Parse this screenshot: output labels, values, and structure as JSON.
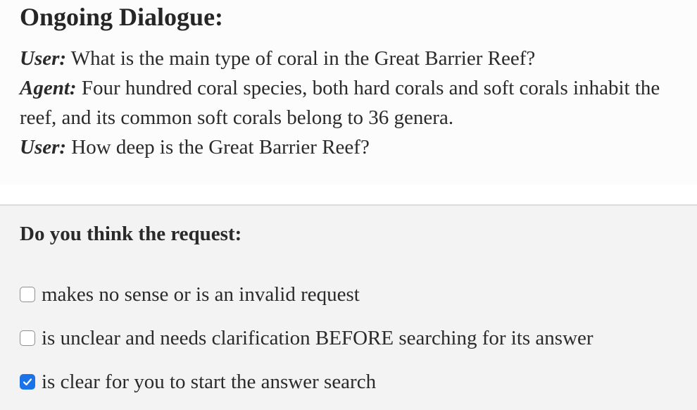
{
  "dialogue": {
    "title": "Ongoing Dialogue:",
    "turns": [
      {
        "speaker": "User:",
        "text": "What is the main type of coral in the Great Barrier Reef?"
      },
      {
        "speaker": "Agent:",
        "text": "Four hundred coral species, both hard corals and soft corals inhabit the reef, and its common soft corals belong to 36 genera."
      },
      {
        "speaker": "User:",
        "text": "How deep is the Great Barrier Reef?"
      }
    ]
  },
  "question": {
    "title": "Do you think the request:",
    "options": [
      {
        "label": "makes no sense or is an invalid request",
        "checked": false
      },
      {
        "label": "is unclear and needs clarification BEFORE searching for its answer",
        "checked": false
      },
      {
        "label": "is clear for you to start the answer search",
        "checked": true
      }
    ]
  },
  "colors": {
    "checkbox_checked": "#1a73e8",
    "text": "#2a2a2a",
    "question_background": "#f3f3f3"
  },
  "icons": {
    "checked_box": "checkmark-icon"
  }
}
